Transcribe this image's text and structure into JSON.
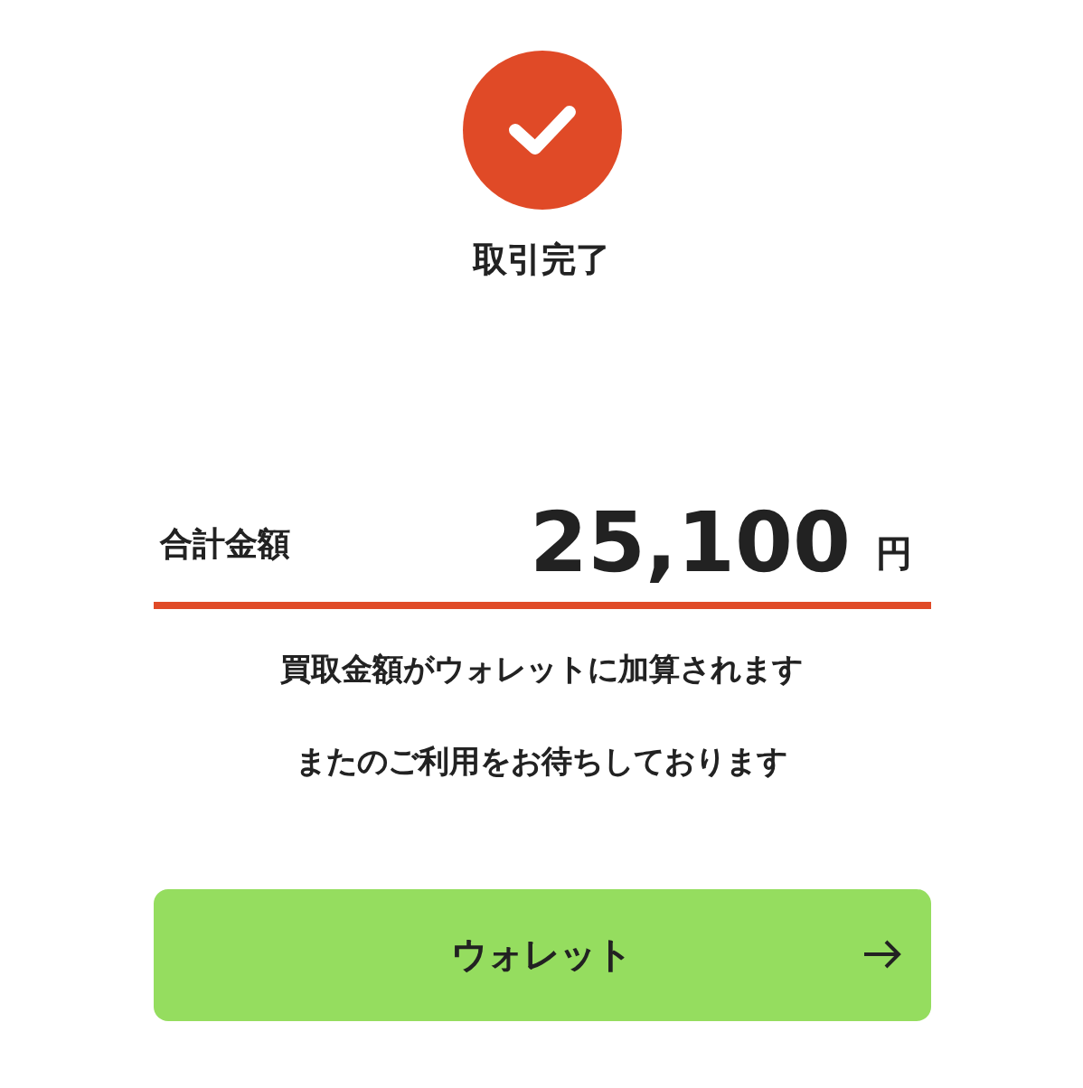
{
  "status": {
    "title": "取引完了"
  },
  "total": {
    "label": "合計金額",
    "amount": "25,100",
    "unit": "円"
  },
  "messages": [
    "買取金額がウォレットに加算されます",
    "またのご利用をお待ちしております"
  ],
  "button": {
    "label": "ウォレット"
  }
}
